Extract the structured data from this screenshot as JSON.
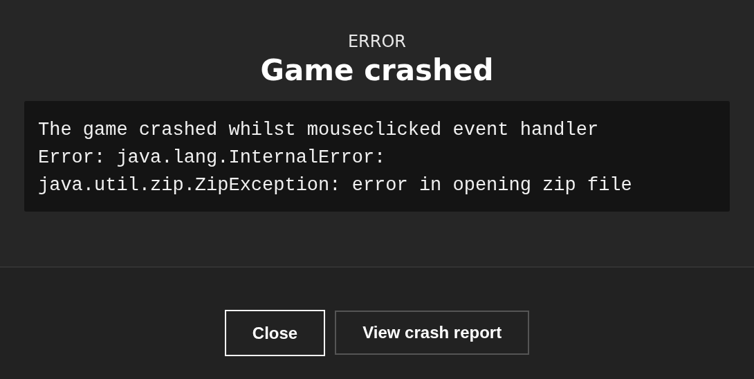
{
  "dialog": {
    "overline": "ERROR",
    "title": "Game crashed",
    "message_lines": [
      "The game crashed whilst mouseclicked event handler",
      "Error: java.lang.InternalError:",
      "java.util.zip.ZipException: error in opening zip file"
    ],
    "buttons": [
      {
        "label": "Close",
        "focused": true
      },
      {
        "label": "View crash report",
        "focused": false
      }
    ]
  }
}
